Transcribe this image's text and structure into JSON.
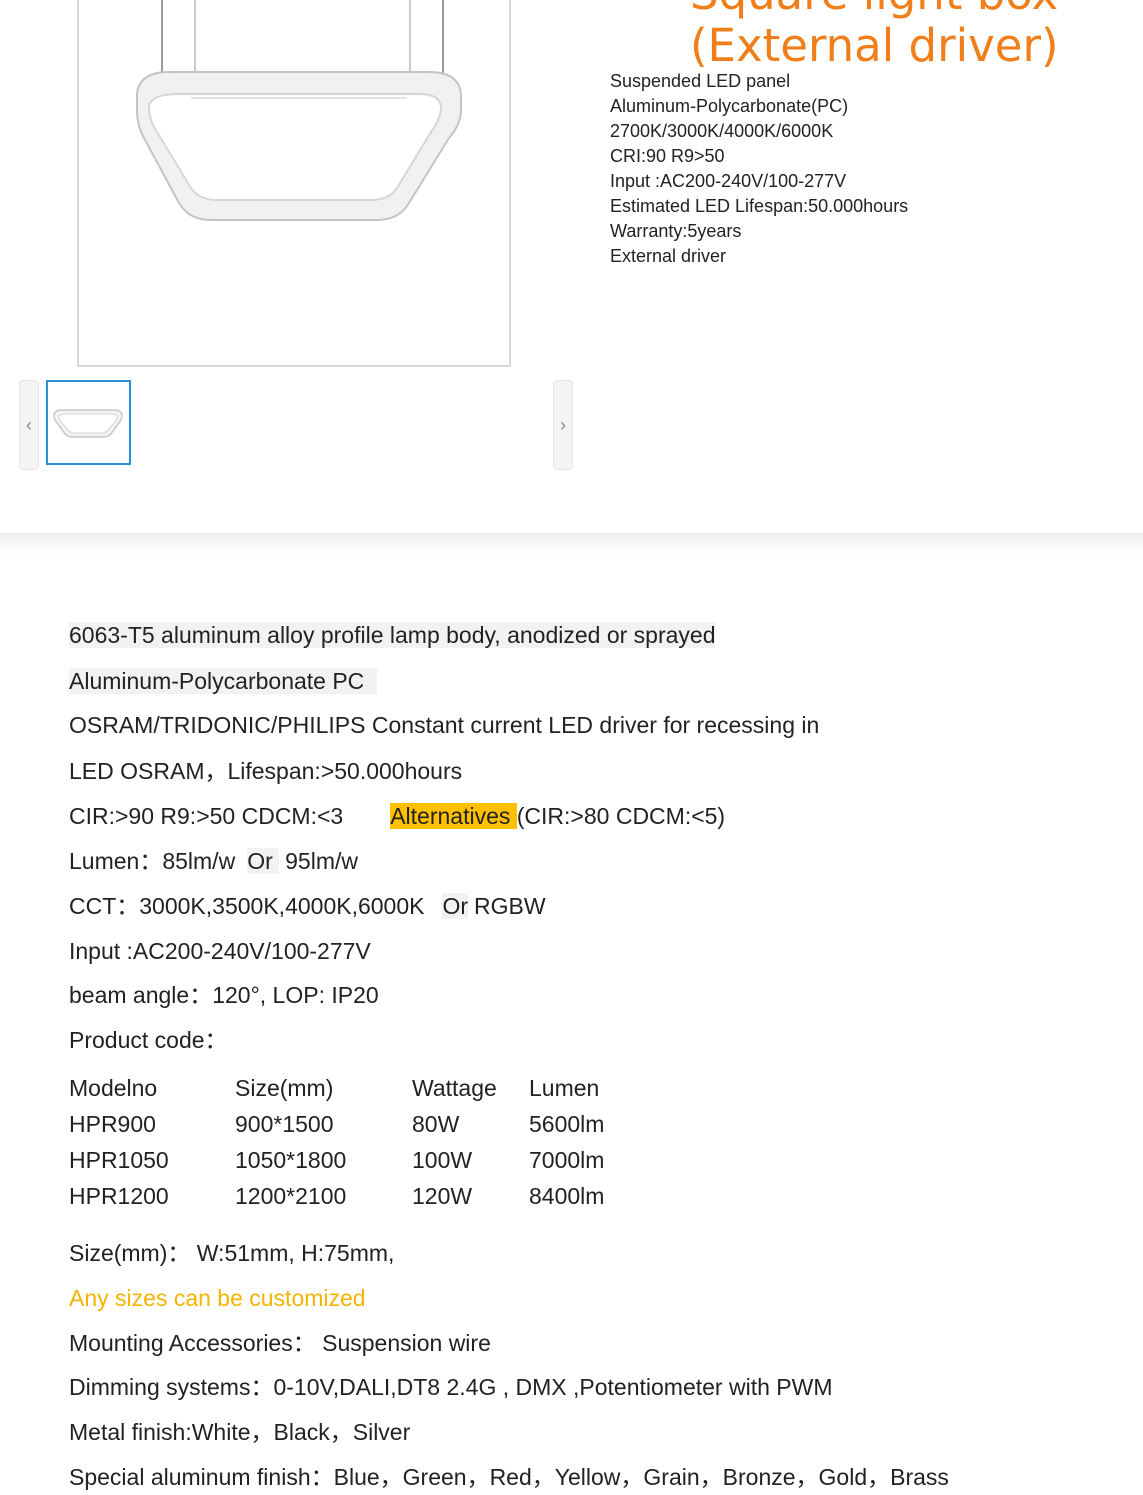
{
  "product": {
    "title_line1": "Square light box",
    "title_line2": "(External driver)",
    "specs": [
      "Suspended LED panel",
      "Aluminum-Polycarbonate(PC)",
      "2700K/3000K/4000K/6000K",
      "CRI:90 R9>50",
      "Input :AC200-240V/100-277V",
      "Estimated LED Lifespan:50.000hours",
      "Warranty:5years",
      "External driver"
    ]
  },
  "gallery": {
    "prev_icon": "chevron-left-icon",
    "next_icon": "chevron-right-icon",
    "prev_glyph": "‹",
    "next_glyph": "›"
  },
  "description": {
    "body_line": "6063-T5 aluminum alloy profile lamp body, anodized or sprayed",
    "material_line": "Aluminum-Polycarbonate  PC",
    "driver_line": "OSRAM/TRIDONIC/PHILIPS Constant current LED driver for recessing in",
    "led_line": "LED  OSRAM，Lifespan:>50.000hours",
    "cri_main": "CIR:>90  R9:>50  CDCM:<3",
    "cri_alt_label": "Alternatives",
    "cri_alt_values": "(CIR:>80   CDCM:<5)",
    "lumen_a": "Lumen：85lm/w",
    "lumen_or": "Or",
    "lumen_b": "95lm/w",
    "cct_a": "CCT：3000K,3500K,4000K,6000K",
    "cct_or": "Or",
    "cct_b": "RGBW",
    "input_line": "Input :AC200-240V/100-277V",
    "beam_line": "beam angle：120°,   LOP:  IP20",
    "product_code_label": "Product code：",
    "table": {
      "headers": [
        "Modelno",
        "Size(mm)",
        "Wattage",
        "Lumen"
      ],
      "rows": [
        [
          "HPR900",
          "900*1500",
          "80W",
          "5600lm"
        ],
        [
          "HPR1050",
          "1050*1800",
          "100W",
          "7000lm"
        ],
        [
          "HPR1200",
          "1200*2100",
          "120W",
          "8400lm"
        ]
      ]
    },
    "size_line": "Size(mm)：   W:51mm,  H:75mm,",
    "custom_line": "Any sizes can be customized",
    "mounting_line": "Mounting Accessories： Suspension wire",
    "dimming_line": "Dimming systems：0-10V,DALI,DT8  2.4G , DMX ,Potentiometer  with PWM",
    "metal_line": "Metal finish:White，Black，Silver",
    "special_line": "Special aluminum finish：Blue，Green，Red，Yellow，Grain，Bronze，Gold，Brass"
  },
  "colors": {
    "title_orange": "#f07f1a",
    "highlight_yellow": "#ffc000",
    "custom_text": "#f5b400",
    "thumb_border": "#2a8fd6"
  }
}
